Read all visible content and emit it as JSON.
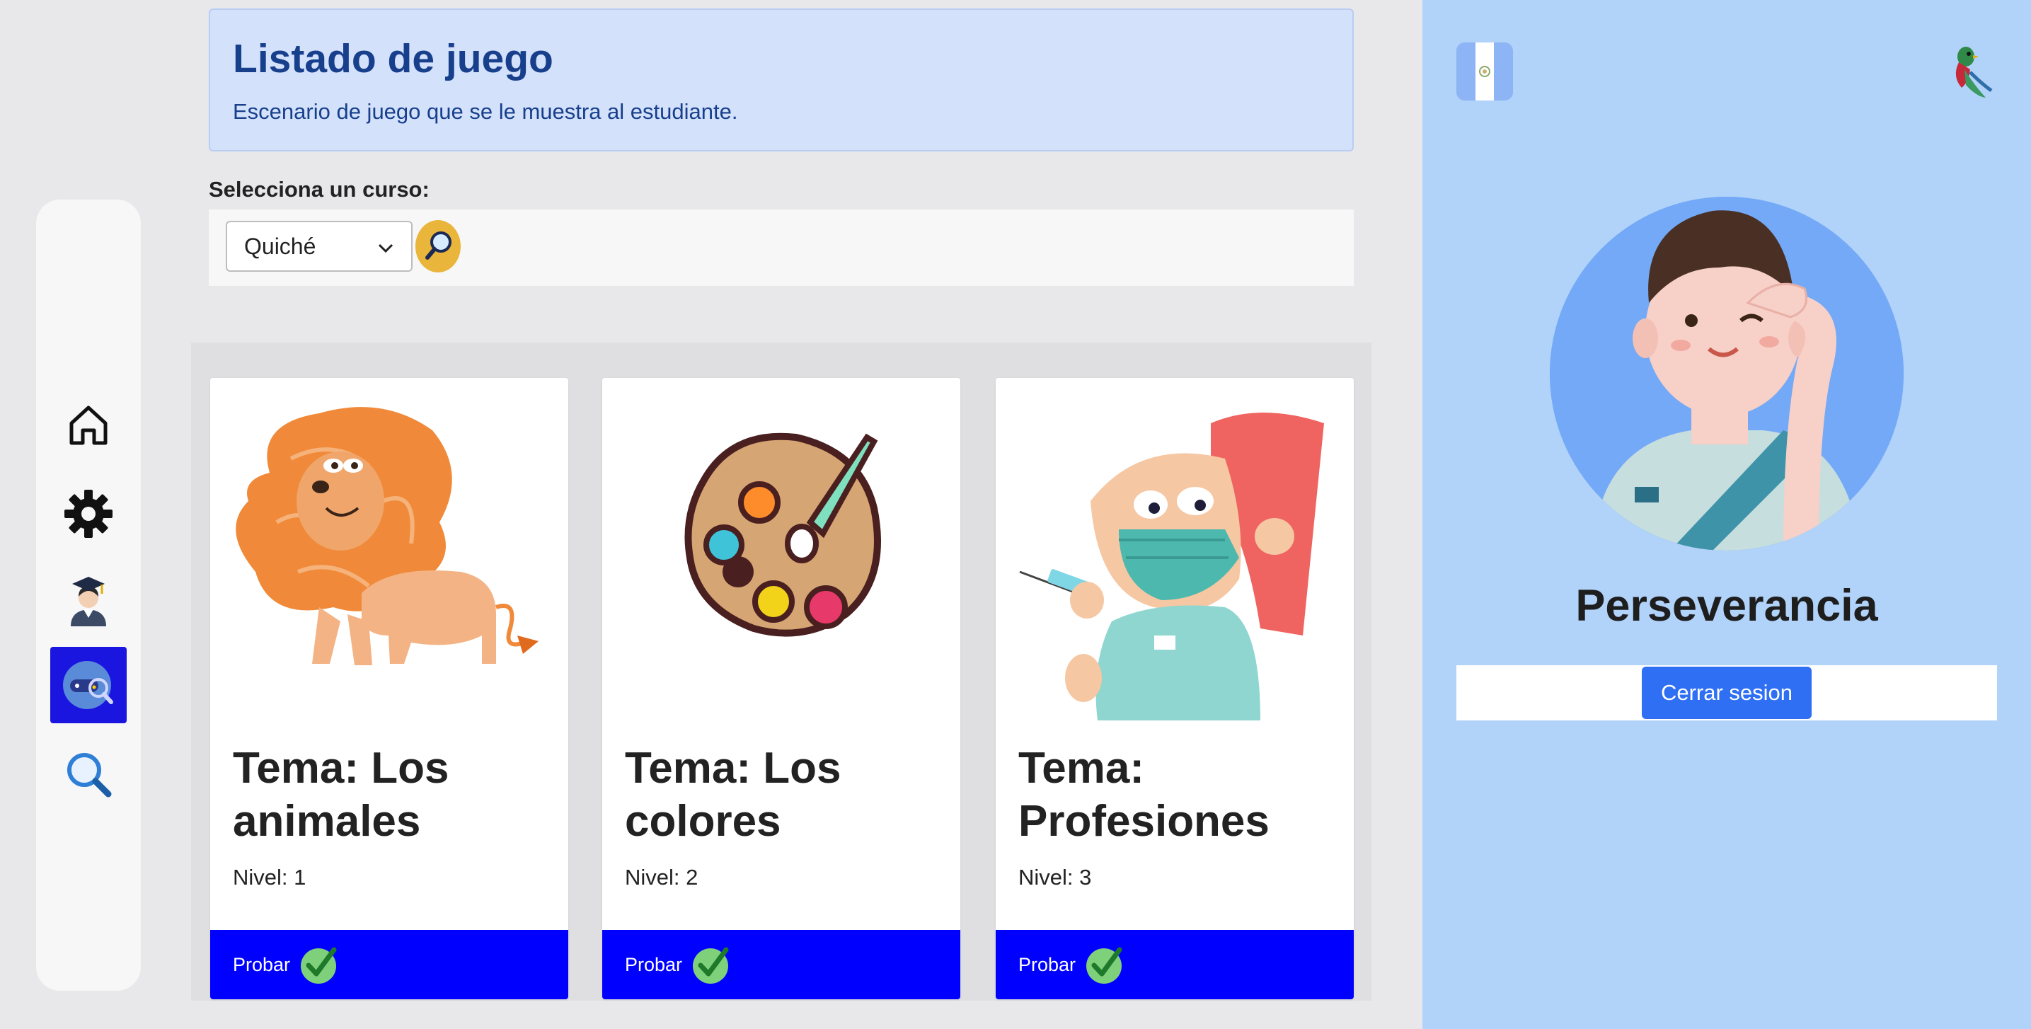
{
  "sidebar": {
    "items": [
      {
        "name": "home-icon",
        "active": false
      },
      {
        "name": "gear-icon",
        "active": false
      },
      {
        "name": "graduate-icon",
        "active": false
      },
      {
        "name": "game-icon",
        "active": true
      },
      {
        "name": "search-icon",
        "active": false
      }
    ]
  },
  "header": {
    "title": "Listado de juego",
    "subtitle": "Escenario de juego que se le muestra al estudiante."
  },
  "course": {
    "label": "Selecciona un curso:",
    "selected": "Quiché"
  },
  "cards": [
    {
      "title": "Tema: Los animales",
      "level": "Nivel: 1",
      "button": "Probar",
      "image": "lion-illustration"
    },
    {
      "title": "Tema: Los colores",
      "level": "Nivel: 2",
      "button": "Probar",
      "image": "paint-palette-illustration"
    },
    {
      "title": "Tema: Profesiones",
      "level": "Nivel: 3",
      "button": "Probar",
      "image": "nurse-illustration"
    }
  ],
  "profile": {
    "name": "Perseverancia",
    "logout_label": "Cerrar sesion"
  },
  "colors": {
    "card_button": "#0000ff",
    "header_bg": "#d3e1fb",
    "right_panel_bg": "#b1d2f9",
    "logout_button": "#2f6ff3"
  }
}
